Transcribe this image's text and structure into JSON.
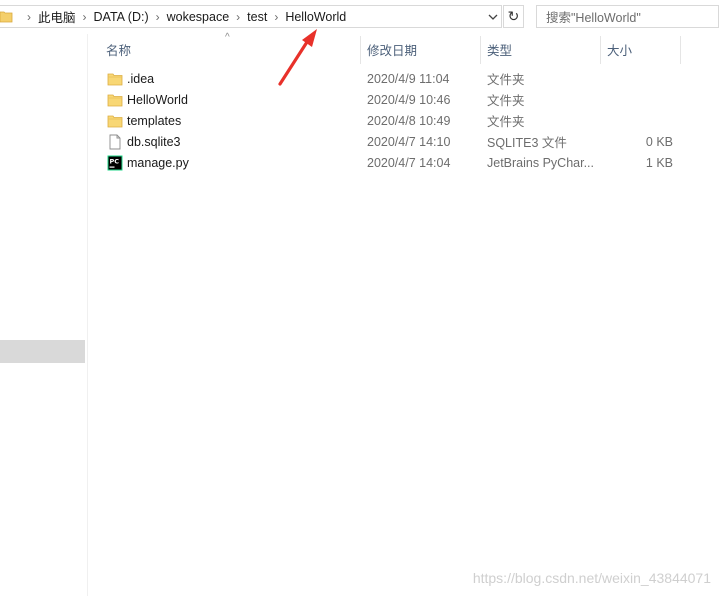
{
  "address_bar": {
    "crumbs": [
      "此电脑",
      "DATA (D:)",
      "wokespace",
      "test",
      "HelloWorld"
    ],
    "dropdown_icon": "chevron-down-icon",
    "refresh_icon": "refresh-icon"
  },
  "search": {
    "placeholder": "搜索\"HelloWorld\""
  },
  "columns": {
    "name": "名称",
    "date": "修改日期",
    "type": "类型",
    "size": "大小"
  },
  "files": [
    {
      "name": ".idea",
      "date": "2020/4/9 11:04",
      "type": "文件夹",
      "size": "",
      "icon": "folder-icon"
    },
    {
      "name": "HelloWorld",
      "date": "2020/4/9 10:46",
      "type": "文件夹",
      "size": "",
      "icon": "folder-icon"
    },
    {
      "name": "templates",
      "date": "2020/4/8 10:49",
      "type": "文件夹",
      "size": "",
      "icon": "folder-icon"
    },
    {
      "name": "db.sqlite3",
      "date": "2020/4/7 14:10",
      "type": "SQLITE3 文件",
      "size": "0 KB",
      "icon": "file-icon"
    },
    {
      "name": "manage.py",
      "date": "2020/4/7 14:04",
      "type": "JetBrains PyChar...",
      "size": "1 KB",
      "icon": "pycharm-icon"
    }
  ],
  "annotation": {
    "color": "#e8312a"
  },
  "watermark": "https://blog.csdn.net/weixin_43844071"
}
